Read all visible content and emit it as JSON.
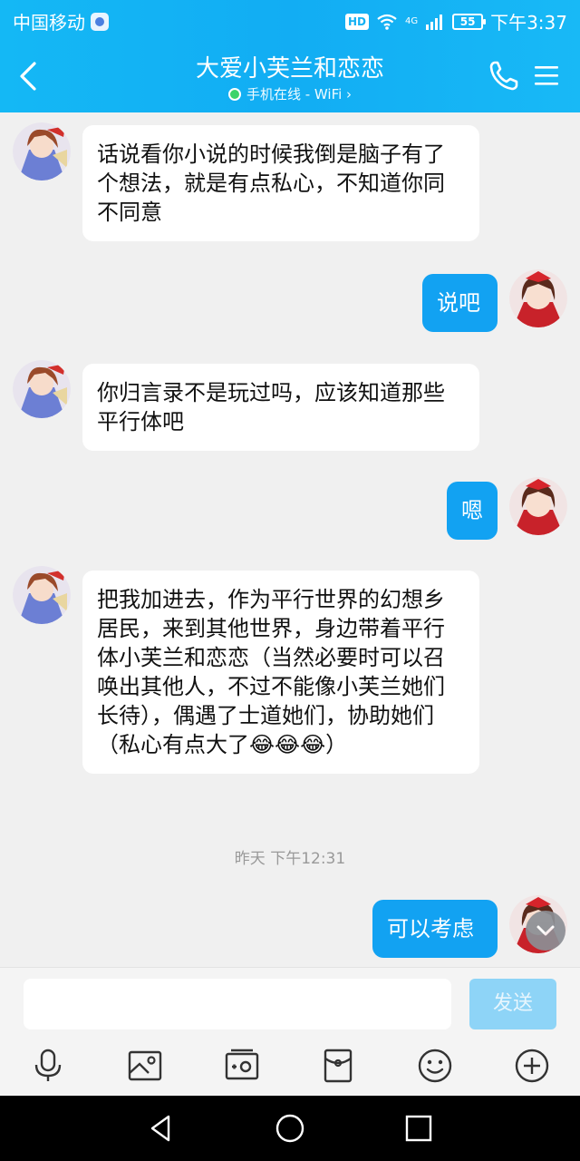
{
  "status_bar": {
    "carrier": "中国移动",
    "hd": "HD",
    "network": "4G",
    "battery": "55",
    "time": "下午3:37"
  },
  "header": {
    "title": "大爱小芙兰和恋恋",
    "subtitle": "手机在线 - WiFi ›"
  },
  "messages": [
    {
      "from": "other",
      "text": "话说看你小说的时候我倒是脑子有了个想法，就是有点私心，不知道你同不同意"
    },
    {
      "from": "me",
      "text": "说吧"
    },
    {
      "from": "other",
      "text": "你归言录不是玩过吗，应该知道那些平行体吧"
    },
    {
      "from": "me",
      "text": "嗯"
    },
    {
      "from": "other",
      "text": "把我加进去，作为平行世界的幻想乡居民，来到其他世界，身边带着平行体小芙兰和恋恋（当然必要时可以召唤出其他人，不过不能像小芙兰她们长待），偶遇了士道她们，协助她们（私心有点大了😂😂😂）"
    },
    {
      "from": "me",
      "text": "可以考虑"
    }
  ],
  "timestamp": "昨天 下午12:31",
  "input": {
    "value": "",
    "placeholder": "",
    "send_label": "发送"
  },
  "toolbar_icons": [
    "microphone-icon",
    "image-icon",
    "video-icon",
    "red-packet-icon",
    "emoji-icon",
    "plus-icon"
  ],
  "colors": {
    "header": "#14b1f4",
    "outgoing_bubble": "#12a2f2",
    "incoming_bubble": "#ffffff",
    "background": "#f0f0f0",
    "send_button": "#8ed4f7"
  }
}
